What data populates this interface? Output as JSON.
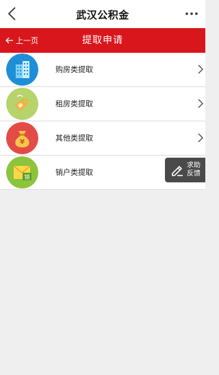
{
  "appbar": {
    "title": "武汉公积金",
    "back_icon": "chevron-left-icon",
    "more_icon": "more-dots-icon"
  },
  "subbar": {
    "prev_label": "上一页",
    "prev_icon": "arrow-left-icon",
    "heading": "提取申请",
    "color": "#d9161c"
  },
  "list": {
    "items": [
      {
        "label": "购房类提取",
        "icon": "building-icon",
        "icon_color": "#1e8fd6",
        "chevron": true
      },
      {
        "label": "租房类提取",
        "icon": "price-tag-icon",
        "icon_color": "#b7d36c",
        "chevron": true
      },
      {
        "label": "其他类提取",
        "icon": "money-bag-icon",
        "icon_color": "#e34b47",
        "chevron": true
      },
      {
        "label": "销户类提取",
        "icon": "envelope-cancel-icon",
        "icon_color": "#8cc43d",
        "chevron": false
      }
    ]
  },
  "help_button": {
    "line1": "求助",
    "line2": "反馈",
    "icon": "pencil-icon"
  }
}
